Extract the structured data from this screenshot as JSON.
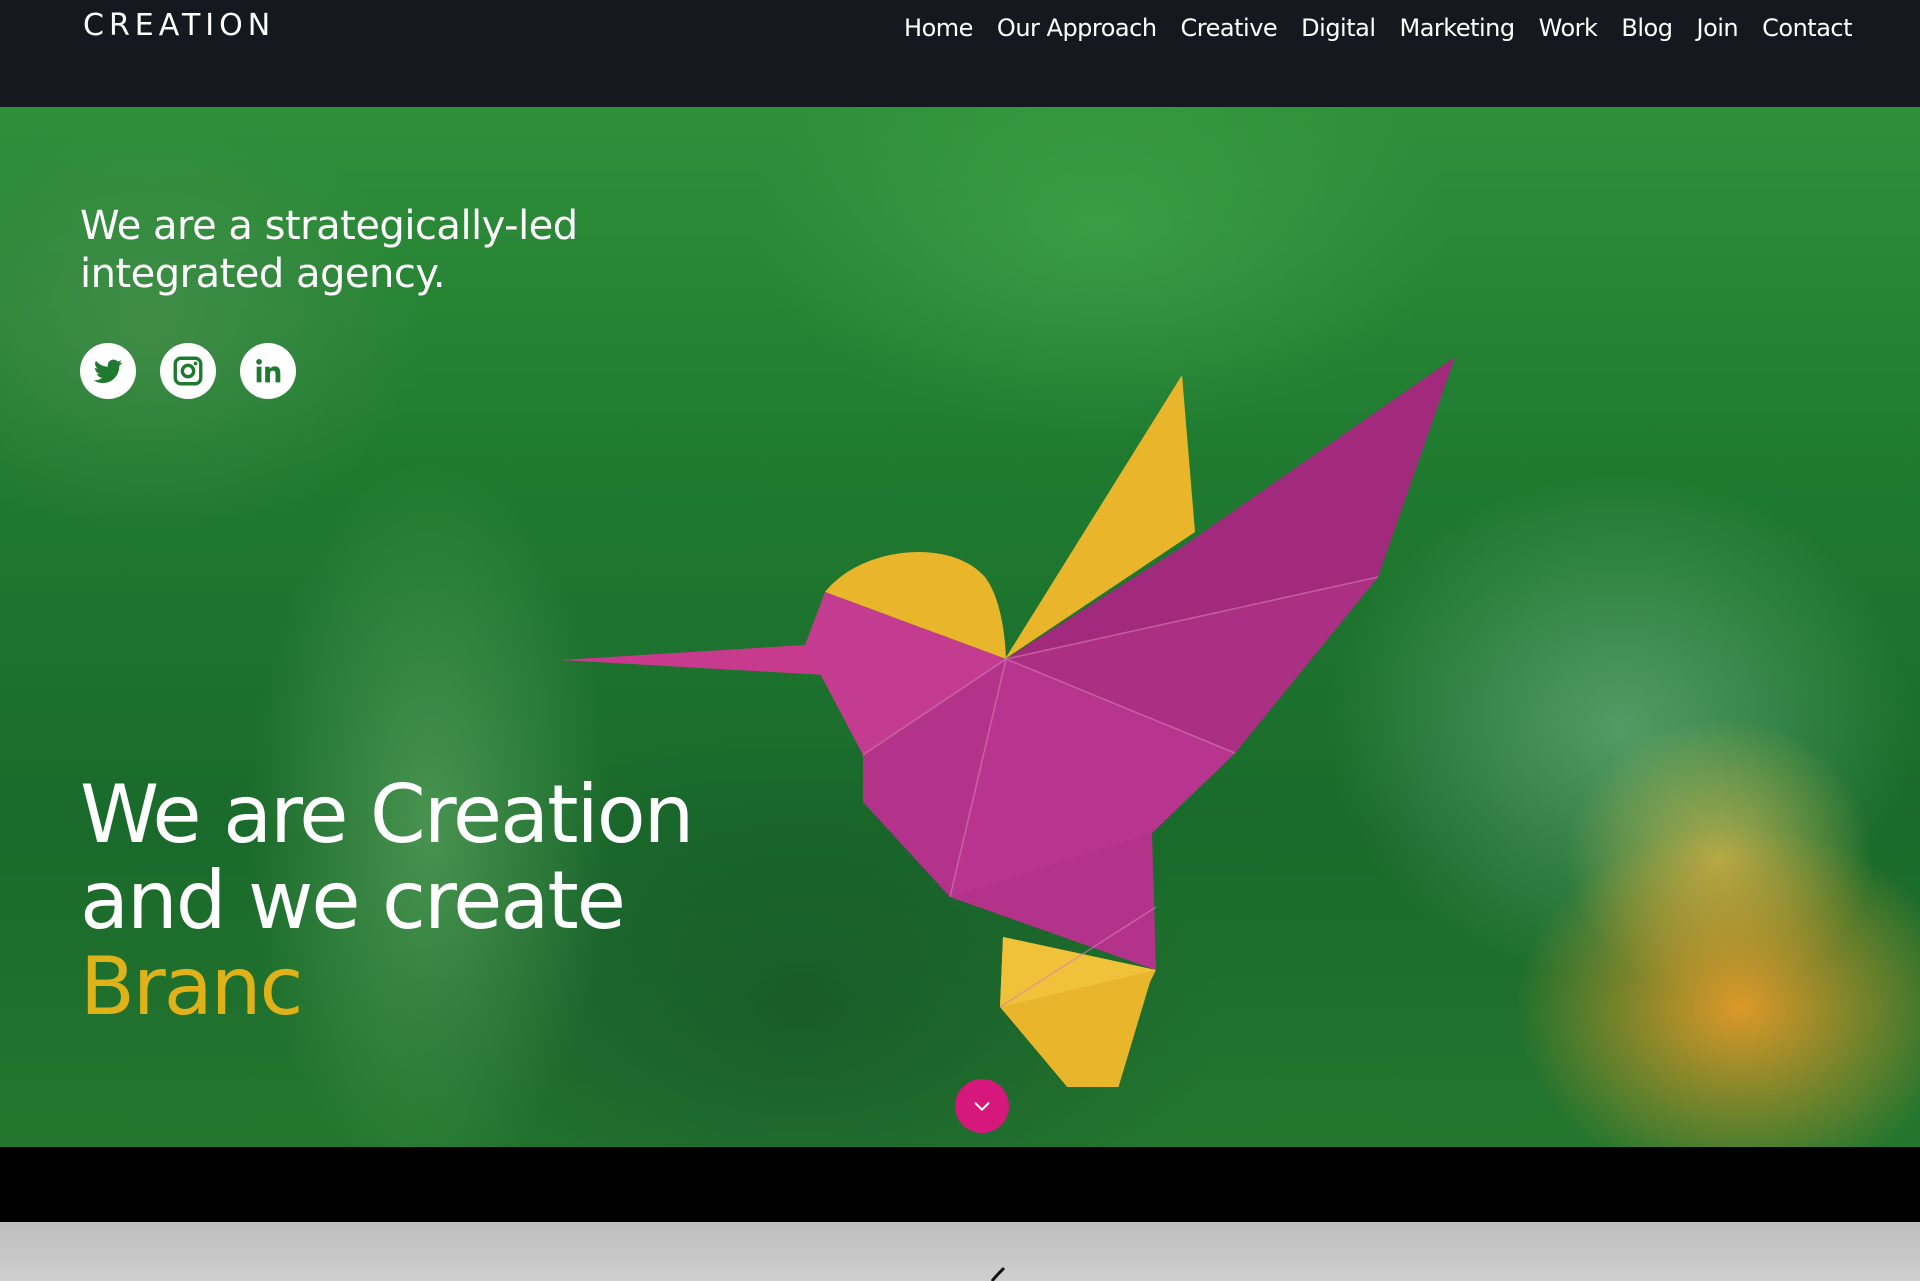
{
  "brand": {
    "logo_text": "CREATION"
  },
  "nav": {
    "items": [
      "Home",
      "Our Approach",
      "Creative",
      "Digital",
      "Marketing",
      "Work",
      "Blog",
      "Join",
      "Contact"
    ]
  },
  "hero": {
    "tagline": "We are a strategically-led integrated agency.",
    "headline_line1": "We are Creation",
    "headline_line2": "and we create",
    "headline_accent": "Branc",
    "socials": [
      {
        "name": "twitter-icon"
      },
      {
        "name": "instagram-icon"
      },
      {
        "name": "linkedin-icon"
      }
    ],
    "scroll_icon": "chevron-down-icon"
  },
  "colors": {
    "nav_background": "#15181e",
    "accent_yellow": "#e0b21a",
    "accent_pink": "#d6177c",
    "bird_magenta": "#b8358f",
    "bird_yellow": "#e9b52a",
    "social_icon_green": "#1f7a30"
  }
}
